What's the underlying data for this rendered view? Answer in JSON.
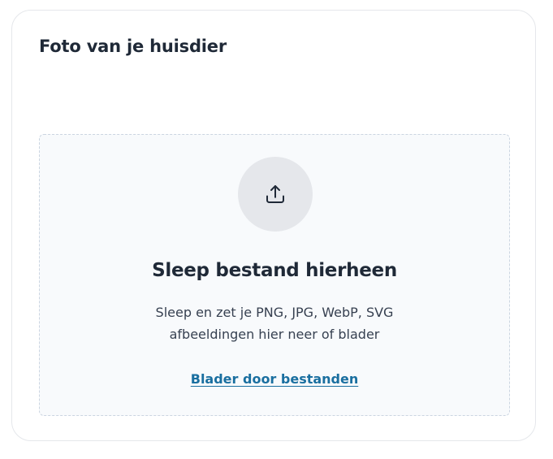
{
  "card": {
    "title": "Foto van je huisdier"
  },
  "dropzone": {
    "icon": "upload-icon",
    "title": "Sleep bestand hierheen",
    "description": "Sleep en zet je PNG, JPG, WebP, SVG afbeeldingen hier neer of blader",
    "browse_link": "Blader door bestanden"
  },
  "colors": {
    "link": "#1a6fa0",
    "dropzone_bg": "#f8fafc",
    "icon_circle": "#e5e7eb",
    "text": "#1f2937"
  }
}
